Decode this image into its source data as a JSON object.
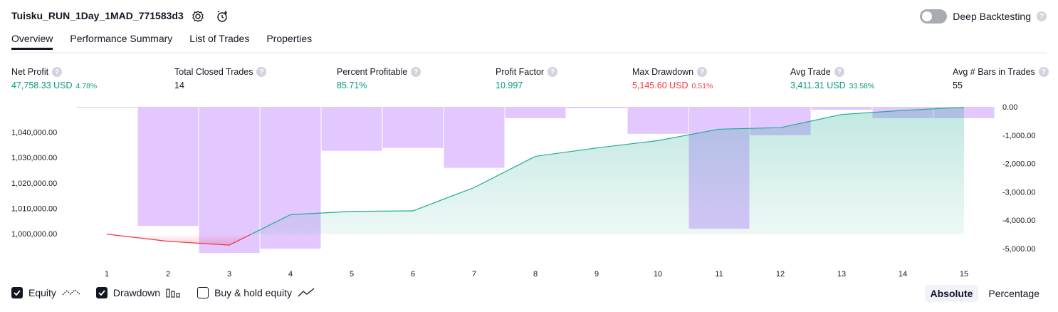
{
  "header": {
    "title": "Tuisku_RUN_1Day_1MAD_771583d3",
    "deep_backtesting_label": "Deep Backtesting",
    "deep_backtesting_on": false,
    "help_glyph": "?"
  },
  "tabs": [
    {
      "label": "Overview",
      "active": true
    },
    {
      "label": "Performance Summary",
      "active": false
    },
    {
      "label": "List of Trades",
      "active": false
    },
    {
      "label": "Properties",
      "active": false
    }
  ],
  "metrics": {
    "net_profit": {
      "label": "Net Profit",
      "value": "47,758.33 USD",
      "pct": "4.78%"
    },
    "total_closed_trades": {
      "label": "Total Closed Trades",
      "value": "14"
    },
    "percent_profitable": {
      "label": "Percent Profitable",
      "value": "85.71%"
    },
    "profit_factor": {
      "label": "Profit Factor",
      "value": "10.997"
    },
    "max_drawdown": {
      "label": "Max Drawdown",
      "value": "5,145.60 USD",
      "pct": "0.51%"
    },
    "avg_trade": {
      "label": "Avg Trade",
      "value": "3,411.31 USD",
      "pct": "33.58%"
    },
    "avg_bars": {
      "label": "Avg # Bars in Trades",
      "value": "55"
    }
  },
  "colors": {
    "positive": "#089981",
    "negative": "#f23645",
    "drawdown_bar": "#e1c4ff",
    "equity_line": "#22ab94",
    "equity_fill": "#c4ebe1"
  },
  "chart_data": {
    "type": "line",
    "x": [
      1,
      2,
      3,
      4,
      5,
      6,
      7,
      8,
      9,
      10,
      11,
      12,
      13,
      14,
      15
    ],
    "series": [
      {
        "name": "Equity",
        "axis": "left",
        "values": [
          999800,
          997000,
          995500,
          1007500,
          1008800,
          1009000,
          1018200,
          1030500,
          1033800,
          1036700,
          1041200,
          1041800,
          1047000,
          1048600,
          1049800
        ]
      },
      {
        "name": "Drawdown",
        "type": "bar",
        "axis": "right",
        "values": [
          0,
          -4200,
          -5150,
          -5000,
          -1550,
          -1450,
          -2150,
          -400,
          -50,
          -950,
          -4300,
          -1000,
          -100,
          -400,
          -400
        ]
      }
    ],
    "left_ticks": [
      "1,000,000.00",
      "1,010,000.00",
      "1,020,000.00",
      "1,030,000.00",
      "1,040,000.00"
    ],
    "right_ticks": [
      "0.00",
      "-1,000.00",
      "-2,000.00",
      "-3,000.00",
      "-4,000.00",
      "-5,000.00"
    ],
    "x_ticks": [
      "1",
      "2",
      "3",
      "4",
      "5",
      "6",
      "7",
      "8",
      "9",
      "10",
      "11",
      "12",
      "13",
      "14",
      "15"
    ],
    "ylim_left": [
      993000,
      1050000
    ],
    "ylim_right": [
      -5100,
      0
    ]
  },
  "legend": {
    "equity": {
      "label": "Equity",
      "checked": true
    },
    "drawdown": {
      "label": "Drawdown",
      "checked": true
    },
    "buy_hold": {
      "label": "Buy & hold equity",
      "checked": false
    }
  },
  "mode": {
    "absolute": "Absolute",
    "percentage": "Percentage",
    "active": "Absolute"
  }
}
